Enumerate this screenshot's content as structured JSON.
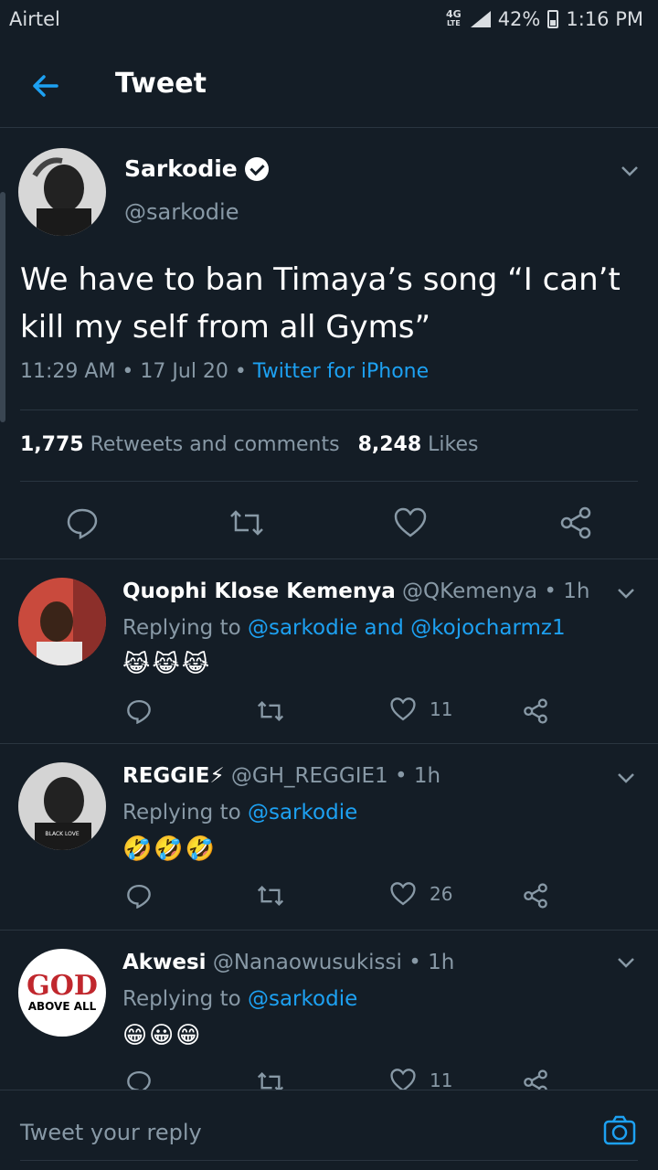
{
  "status_bar": {
    "carrier": "Airtel",
    "network": "4G",
    "lte": "LTE",
    "battery": "42%",
    "time": "1:16 PM"
  },
  "header": {
    "title": "Tweet"
  },
  "main_tweet": {
    "name": "Sarkodie",
    "handle": "@sarkodie",
    "text": "We have to ban Timaya’s song “I can’t kill my self from all Gyms”",
    "time": "11:29 AM",
    "date": "17 Jul 20",
    "source": "Twitter for iPhone",
    "retweets_count": "1,775",
    "retweets_label": "Retweets and comments",
    "likes_count": "8,248",
    "likes_label": "Likes"
  },
  "replies": [
    {
      "name": "Quophi Klose Kemenya",
      "handle": "@QKemenya",
      "time": "1h",
      "replying_prefix": "Replying to",
      "replying_to": "@sarkodie and @kojocharmz1",
      "emoji": "😹😹😹",
      "likes": "11"
    },
    {
      "name": "REGGIE⚡",
      "handle": "@GH_REGGIE1",
      "time": "1h",
      "replying_prefix": "Replying to",
      "replying_to": "@sarkodie",
      "emoji": "🤣🤣🤣",
      "likes": "26",
      "avatar_text": "BLACK LOVE"
    },
    {
      "name": "Akwesi",
      "handle": "@Nanaowusukissi",
      "time": "1h",
      "replying_prefix": "Replying to",
      "replying_to": "@sarkodie",
      "emoji": "😁😀😁",
      "likes": "11",
      "avatar_text_1": "GOD",
      "avatar_text_2": "ABOVE ALL"
    }
  ],
  "composer": {
    "placeholder": "Tweet your reply"
  },
  "colors": {
    "background": "#141d26",
    "accent": "#1da1f2",
    "muted": "#8899a6",
    "divider": "#2a3540"
  }
}
